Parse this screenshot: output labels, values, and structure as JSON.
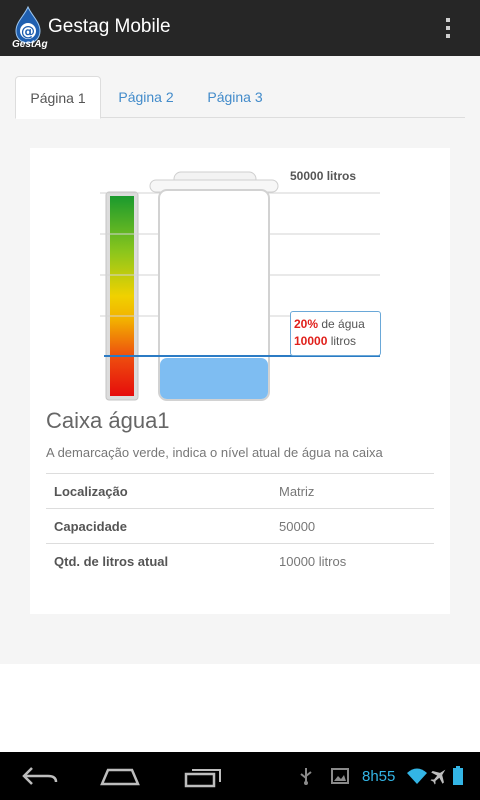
{
  "app": {
    "title": "Gestag Mobile",
    "logo_text": "GestAg",
    "logo_icon": "at-sign-drop-logo",
    "overflow_icon": "overflow-menu-icon"
  },
  "tabs": [
    {
      "label": "Página 1",
      "active": true
    },
    {
      "label": "Página 2",
      "active": false
    },
    {
      "label": "Página 3",
      "active": false
    }
  ],
  "tank": {
    "capacity_label": "50000 litros",
    "level_percent": "20%",
    "level_percent_suffix": "de água",
    "level_liters": "10000",
    "level_liters_suffix": "litros",
    "fill_fraction": 0.2,
    "name": "Caixa água1",
    "description": "A demarcação verde, indica o nível atual de água na caixa",
    "details": [
      {
        "label": "Localização",
        "value": "Matriz"
      },
      {
        "label": "Capacidade",
        "value": "50000"
      },
      {
        "label": "Qtd. de litros atual",
        "value": "10000 litros"
      }
    ]
  },
  "colors": {
    "action_bar": "#262626",
    "link": "#428bca",
    "water": "#7ebdf2",
    "level_red": "#e0201b",
    "clock": "#33b5e5"
  },
  "system_bar": {
    "time": "8h55",
    "icons": [
      "back-icon",
      "home-icon",
      "recent-apps-icon",
      "usb-icon",
      "image-icon",
      "wifi-icon",
      "airplane-icon",
      "battery-icon"
    ]
  }
}
